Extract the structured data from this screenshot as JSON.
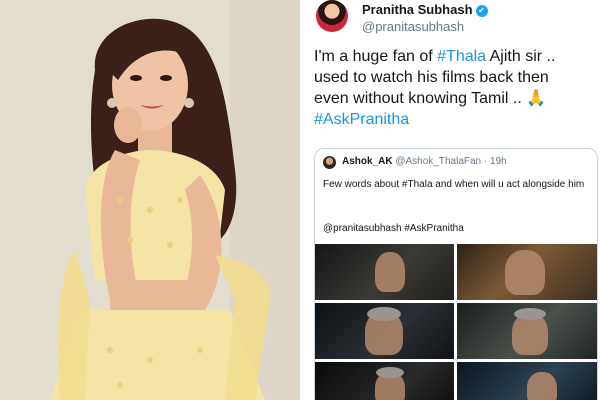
{
  "tweet": {
    "author": {
      "name": "Pranitha Subhash",
      "handle": "@pranitasubhash",
      "verified_icon": "✔"
    },
    "text": {
      "line1_pre": "I'm a huge fan of ",
      "line1_tag": "#Thala",
      "line1_post": " Ajith sir ..",
      "line2": "used to watch his films back then",
      "line3": "even without knowing Tamil ..",
      "emoji": "🙏",
      "hashtag": "#AskPranitha"
    },
    "quoted": {
      "name": "Ashok_AK",
      "handle": "@Ashok_ThalaFan",
      "separator": "·",
      "time": "19h",
      "text": "Few words about #Thala and when will u act alongside him",
      "mentions": "@pranitasubhash #AskPranitha",
      "images_count": 6
    }
  },
  "colors": {
    "link": "#1b95e0",
    "text": "#14171a",
    "muted": "#657786",
    "verified": "#1da1f2",
    "border": "#ccd6dd",
    "dress": "#f3e4a6"
  },
  "icons": {
    "verified": "verified-badge-icon",
    "emoji": "folded-hands-icon"
  }
}
